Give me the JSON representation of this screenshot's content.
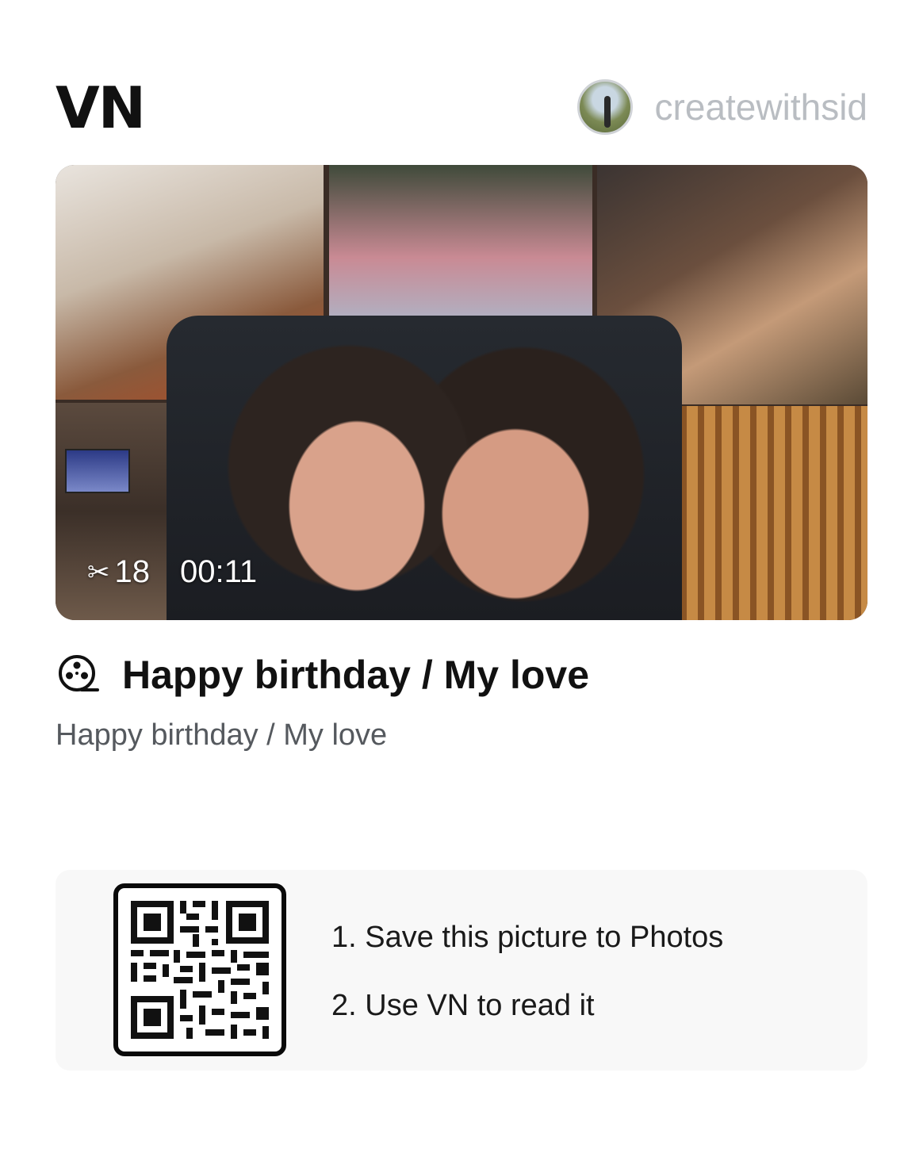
{
  "app": {
    "logo": "VN"
  },
  "user": {
    "name": "createwithsid",
    "avatar_icon": "avatar"
  },
  "preview": {
    "clip_count": "18",
    "duration": "00:11",
    "scissor_icon": "scissors-icon"
  },
  "project": {
    "icon": "film-reel-icon",
    "title": "Happy birthday / My love",
    "subtitle": "Happy birthday / My love"
  },
  "instructions": {
    "qr_icon": "qr-code",
    "steps": [
      "1. Save this picture to Photos",
      "2. Use VN to read it"
    ]
  }
}
